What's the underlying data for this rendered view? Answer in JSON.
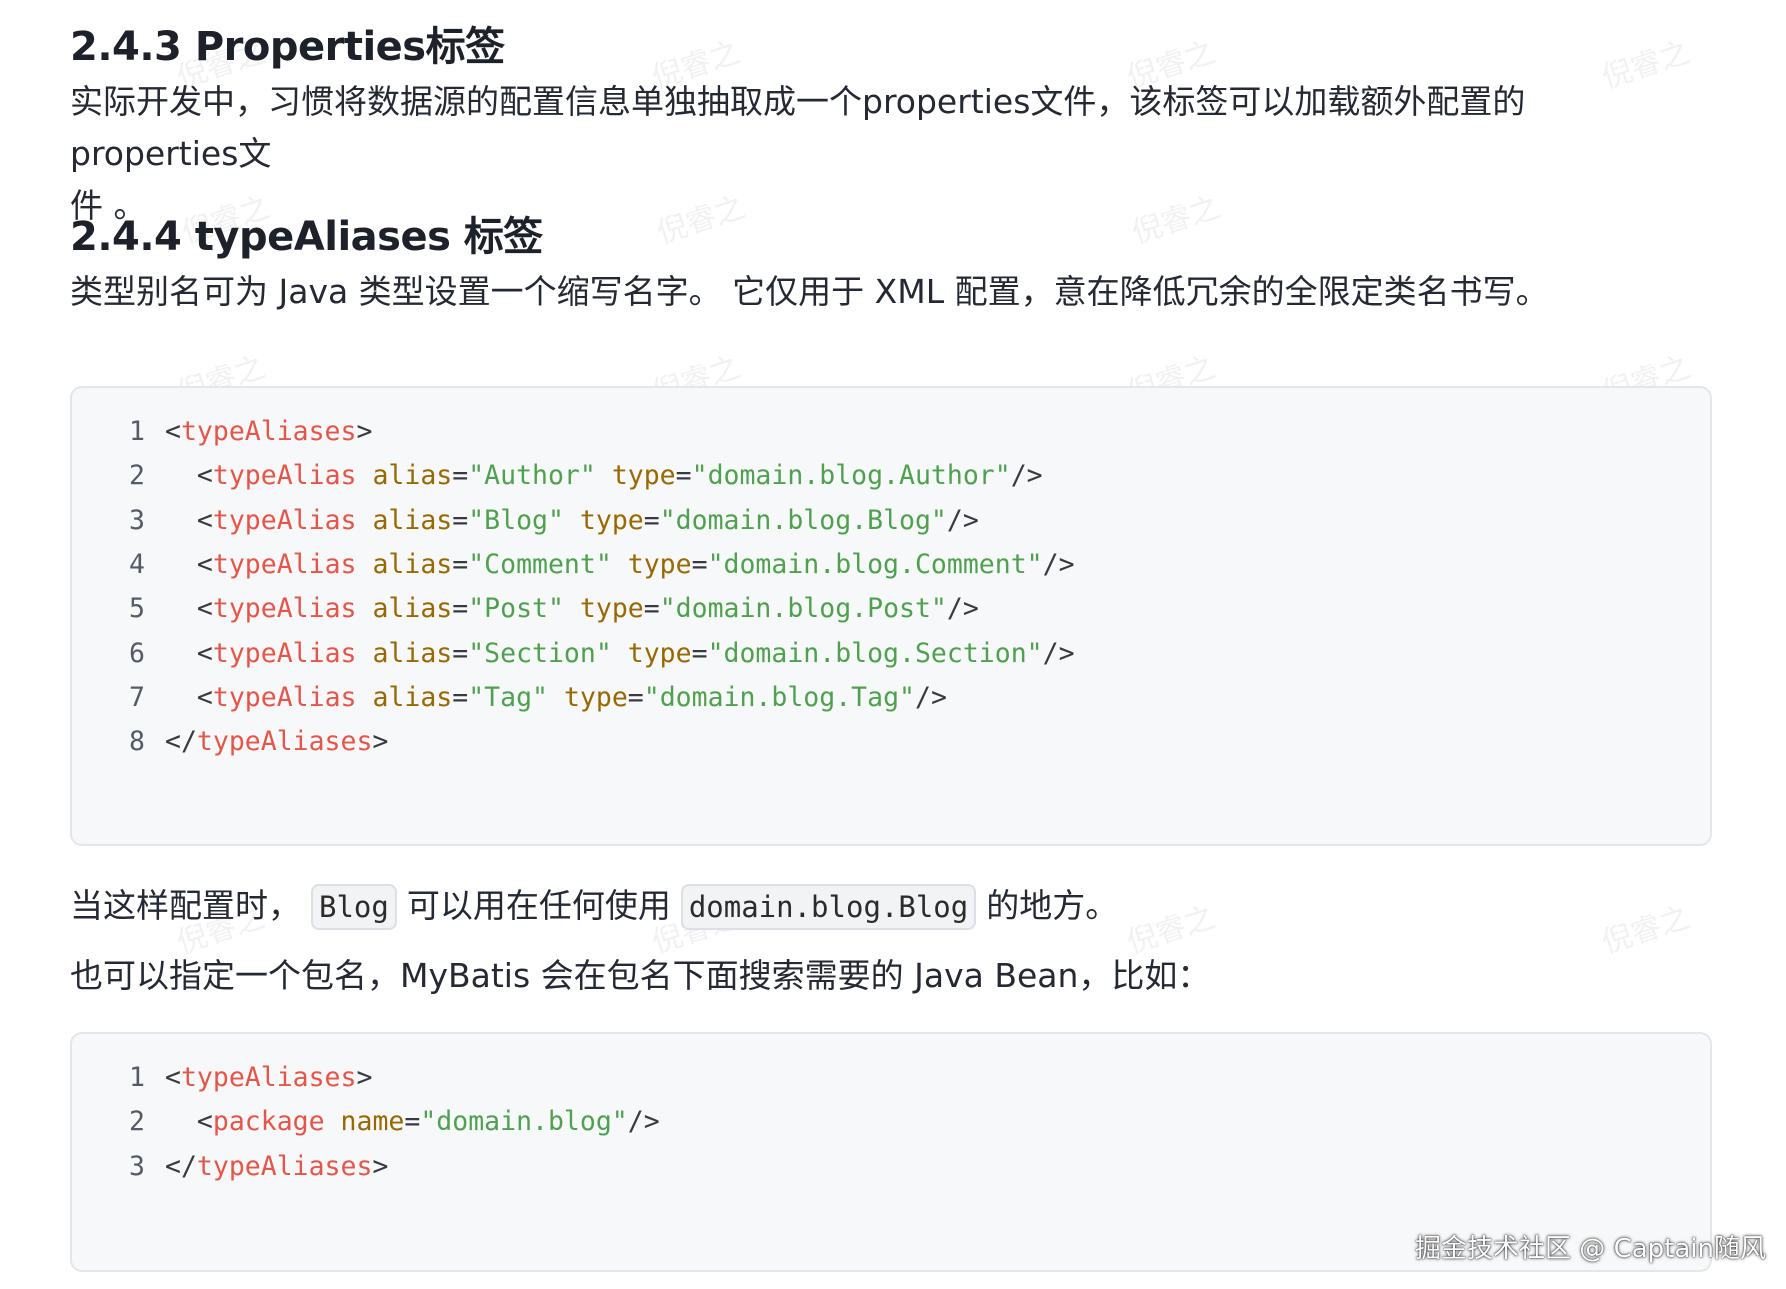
{
  "section_243": {
    "heading": "2.4.3 Properties标签",
    "paragraph_line1": "实际开发中，习惯将数据源的配置信息单独抽取成一个properties文件，该标签可以加载额外配置的 properties文",
    "paragraph_line2": "件 。"
  },
  "section_244": {
    "heading": "2.4.4 typeAliases 标签",
    "paragraph": "类型别名可为 Java 类型设置一个缩写名字。 它仅用于 XML 配置，意在降低冗余的全限定类名书写。"
  },
  "code_block_1": {
    "lines": [
      {
        "num": "1",
        "indent": "",
        "open": "<",
        "tag": "typeAliases",
        "attrs": [],
        "close": ">"
      },
      {
        "num": "2",
        "indent": "  ",
        "open": "<",
        "tag": "typeAlias",
        "attrs": [
          {
            "name": "alias",
            "value": "\"Author\""
          },
          {
            "name": "type",
            "value": "\"domain.blog.Author\""
          }
        ],
        "close": "/>"
      },
      {
        "num": "3",
        "indent": "  ",
        "open": "<",
        "tag": "typeAlias",
        "attrs": [
          {
            "name": "alias",
            "value": "\"Blog\""
          },
          {
            "name": "type",
            "value": "\"domain.blog.Blog\""
          }
        ],
        "close": "/>"
      },
      {
        "num": "4",
        "indent": "  ",
        "open": "<",
        "tag": "typeAlias",
        "attrs": [
          {
            "name": "alias",
            "value": "\"Comment\""
          },
          {
            "name": "type",
            "value": "\"domain.blog.Comment\""
          }
        ],
        "close": "/>"
      },
      {
        "num": "5",
        "indent": "  ",
        "open": "<",
        "tag": "typeAlias",
        "attrs": [
          {
            "name": "alias",
            "value": "\"Post\""
          },
          {
            "name": "type",
            "value": "\"domain.blog.Post\""
          }
        ],
        "close": "/>"
      },
      {
        "num": "6",
        "indent": "  ",
        "open": "<",
        "tag": "typeAlias",
        "attrs": [
          {
            "name": "alias",
            "value": "\"Section\""
          },
          {
            "name": "type",
            "value": "\"domain.blog.Section\""
          }
        ],
        "close": "/>"
      },
      {
        "num": "7",
        "indent": "  ",
        "open": "<",
        "tag": "typeAlias",
        "attrs": [
          {
            "name": "alias",
            "value": "\"Tag\""
          },
          {
            "name": "type",
            "value": "\"domain.blog.Tag\""
          }
        ],
        "close": "/>"
      },
      {
        "num": "8",
        "indent": "",
        "open": "</",
        "tag": "typeAliases",
        "attrs": [],
        "close": ">"
      }
    ]
  },
  "usage_note": {
    "before": "当这样配置时，",
    "code1": "Blog",
    "middle": "可以用在任何使用",
    "code2": "domain.blog.Blog",
    "after": "的地方。"
  },
  "package_note": "也可以指定一个包名，MyBatis 会在包名下面搜索需要的 Java Bean，比如：",
  "code_block_2": {
    "lines": [
      {
        "num": "1",
        "indent": "",
        "open": "<",
        "tag": "typeAliases",
        "attrs": [],
        "close": ">"
      },
      {
        "num": "2",
        "indent": "  ",
        "open": "<",
        "tag": "package",
        "attrs": [
          {
            "name": "name",
            "value": "\"domain.blog\""
          }
        ],
        "close": "/>"
      },
      {
        "num": "3",
        "indent": "",
        "open": "</",
        "tag": "typeAliases",
        "attrs": [],
        "close": ">"
      }
    ]
  },
  "watermark_text": "倪睿之",
  "footer_credit": "掘金技术社区 @ Captain随风",
  "colors": {
    "tag": "#e45649",
    "attr": "#986801",
    "string": "#50a14f",
    "code_bg": "#f7f8fa"
  }
}
